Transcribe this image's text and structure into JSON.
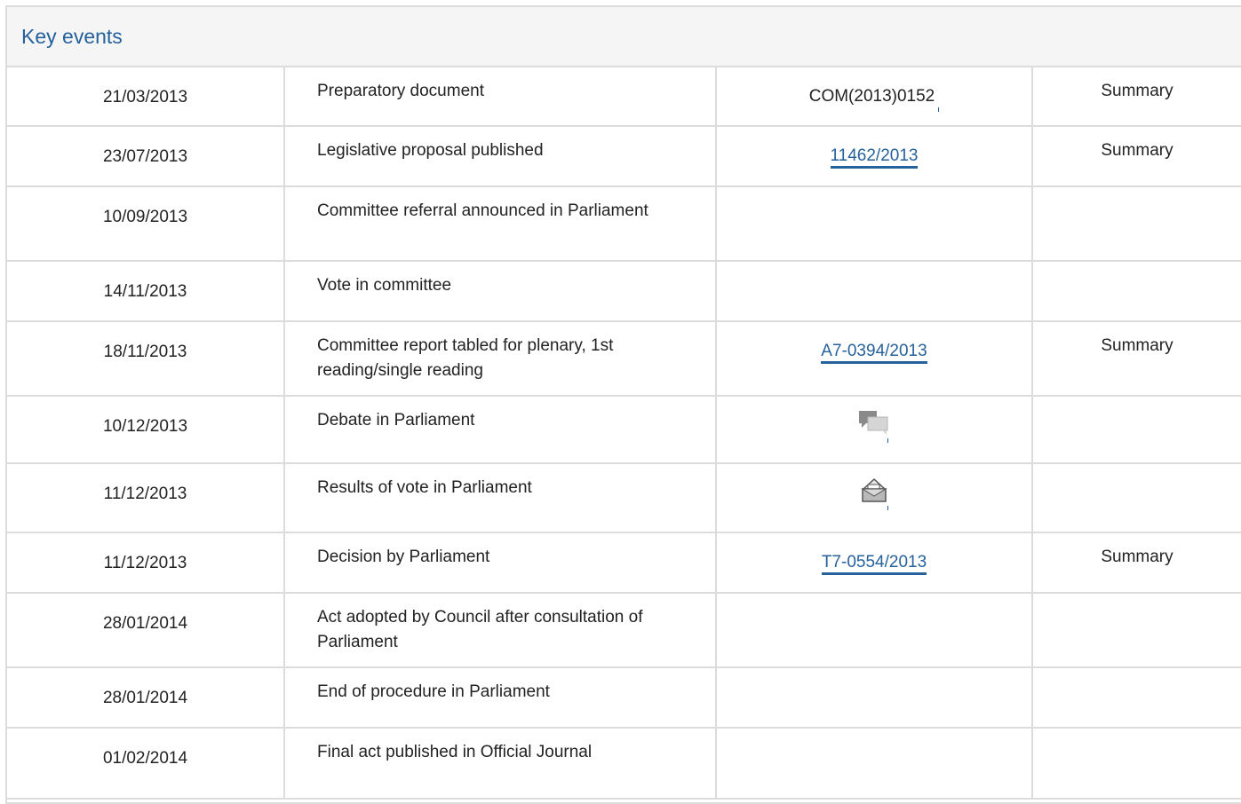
{
  "panel": {
    "title": "Key events"
  },
  "rows": [
    {
      "date": "21/03/2013",
      "event": "Preparatory document",
      "doc": "COM(2013)0152",
      "doc_type": "text",
      "summary": "Summary"
    },
    {
      "date": "23/07/2013",
      "event": "Legislative proposal published",
      "doc": "11462/2013",
      "doc_type": "link",
      "summary": "Summary"
    },
    {
      "date": "10/09/2013",
      "event": "Committee referral announced in Parliament",
      "doc": "",
      "doc_type": "none",
      "summary": ""
    },
    {
      "date": "14/11/2013",
      "event": "Vote in committee",
      "doc": "",
      "doc_type": "none",
      "summary": ""
    },
    {
      "date": "18/11/2013",
      "event": "Committee report tabled for plenary, 1st reading/single reading",
      "doc": "A7-0394/2013",
      "doc_type": "link",
      "summary": "Summary"
    },
    {
      "date": "10/12/2013",
      "event": "Debate in Parliament",
      "doc": "",
      "doc_type": "icon",
      "icon": "debate-icon",
      "summary": ""
    },
    {
      "date": "11/12/2013",
      "event": "Results of vote in Parliament",
      "doc": "",
      "doc_type": "icon",
      "icon": "vote-results-icon",
      "summary": ""
    },
    {
      "date": "11/12/2013",
      "event": "Decision by Parliament",
      "doc": "T7-0554/2013",
      "doc_type": "link",
      "summary": "Summary"
    },
    {
      "date": "28/01/2014",
      "event": "Act adopted by Council after consultation of Parliament",
      "doc": "",
      "doc_type": "none",
      "summary": ""
    },
    {
      "date": "28/01/2014",
      "event": "End of procedure in Parliament",
      "doc": "",
      "doc_type": "none",
      "summary": ""
    },
    {
      "date": "01/02/2014",
      "event": "Final act published in Official Journal",
      "doc": "",
      "doc_type": "none",
      "summary": ""
    }
  ],
  "colors": {
    "link": "#25619b",
    "border": "#dcdcdc",
    "header_bg": "#f5f5f5"
  }
}
